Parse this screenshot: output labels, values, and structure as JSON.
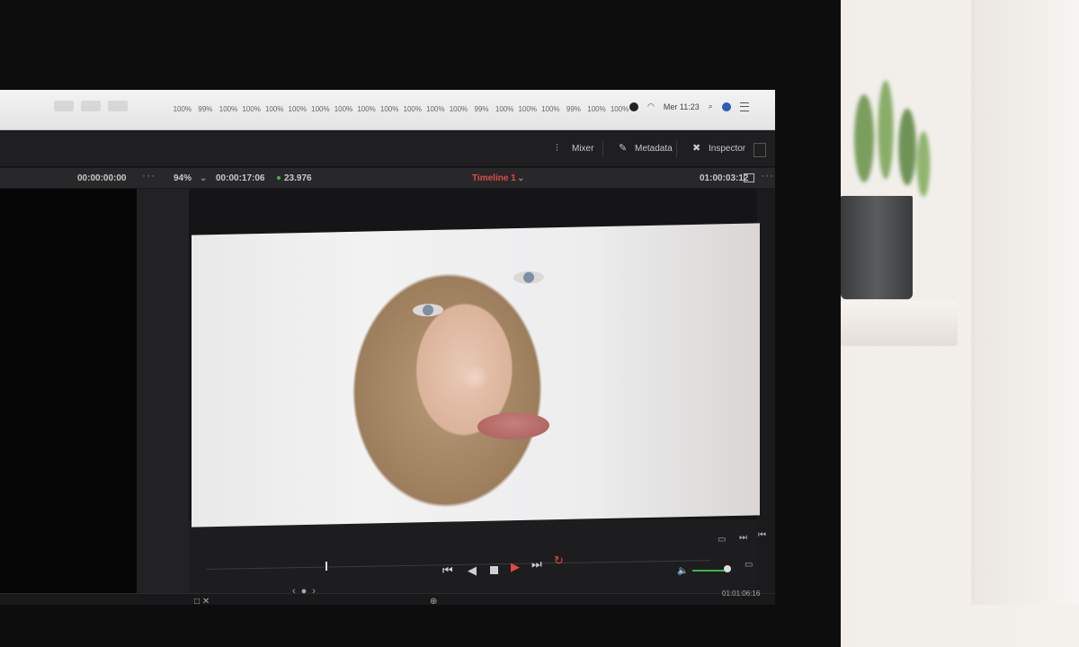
{
  "menubar": {
    "stats": [
      "100%",
      "99%",
      "100%",
      "100%",
      "100%",
      "100%",
      "100%",
      "100%",
      "100%",
      "100%",
      "100%",
      "100%",
      "100%",
      "99%",
      "100%",
      "100%",
      "100%",
      "99%",
      "100%",
      "100%"
    ],
    "clock": "Mer 11:23"
  },
  "toolbar": {
    "mixer_label": "Mixer",
    "metadata_label": "Metadata",
    "inspector_label": "Inspector"
  },
  "infobar": {
    "source_timecode": "00:00:00:00",
    "zoom": "94%",
    "duration": "00:00:17:06",
    "framerate": "23.976",
    "timeline_name": "Timeline 1",
    "timeline_timecode": "01:00:03:12"
  },
  "transport": {
    "bottom_timecode": "01:01:06:16"
  },
  "colors": {
    "accent_red": "#e24a43",
    "volume_green": "#39b54a"
  }
}
